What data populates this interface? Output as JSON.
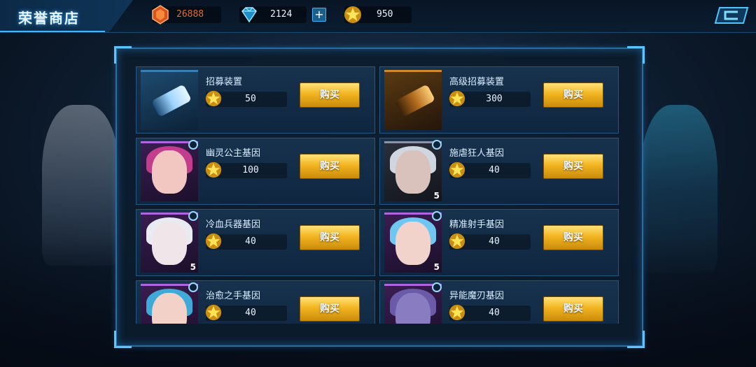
{
  "header": {
    "title": "荣誉商店",
    "currencies": {
      "crystal": {
        "value": "26888",
        "color": "#e96a2b",
        "icon": "orange-crystal-icon"
      },
      "diamond": {
        "value": "2124",
        "color": "#5fd0ff",
        "icon": "diamond-icon"
      },
      "star": {
        "value": "950",
        "color": "#f5c62a",
        "icon": "star-coin-icon"
      }
    },
    "add_label": "+"
  },
  "shop": {
    "buy_label": "购买",
    "items": [
      {
        "name": "招募装置",
        "price": "50"
      },
      {
        "name": "高级招募装置",
        "price": "300"
      },
      {
        "name": "幽灵公主基因",
        "price": "100"
      },
      {
        "name": "施虐狂人基因",
        "price": "40",
        "level": "5"
      },
      {
        "name": "冷血兵器基因",
        "price": "40",
        "level": "5"
      },
      {
        "name": "精准射手基因",
        "price": "40",
        "level": "5"
      },
      {
        "name": "治愈之手基因",
        "price": "40"
      },
      {
        "name": "异能魔刃基因",
        "price": "40"
      }
    ]
  }
}
